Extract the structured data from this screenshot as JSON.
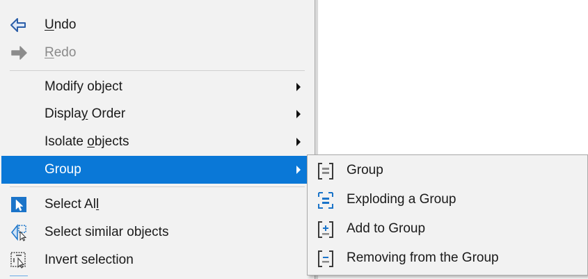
{
  "context_menu": {
    "items": [
      {
        "label_pre": "",
        "label_ul": "U",
        "label_post": "ndo",
        "icon": "undo-arrow-icon"
      },
      {
        "label_pre": "",
        "label_ul": "R",
        "label_post": "edo",
        "icon": "redo-arrow-icon"
      },
      {
        "label_pre": "Modify object",
        "label_ul": "",
        "label_post": ""
      },
      {
        "label_pre": "Displa",
        "label_ul": "y",
        "label_post": " Order"
      },
      {
        "label_pre": "Isolate ",
        "label_ul": "o",
        "label_post": "bjects"
      },
      {
        "label_pre": "Group",
        "label_ul": "",
        "label_post": ""
      },
      {
        "label_pre": "Select Al",
        "label_ul": "l",
        "label_post": "",
        "icon": "select-all-icon"
      },
      {
        "label_pre": "Select similar objects",
        "label_ul": "",
        "label_post": "",
        "icon": "select-similar-icon"
      },
      {
        "label_pre": "Invert selection",
        "label_ul": "",
        "label_post": "",
        "icon": "invert-selection-icon"
      }
    ]
  },
  "group_submenu": {
    "items": [
      {
        "label": "Group",
        "icon": "group-icon"
      },
      {
        "label": "Exploding a Group",
        "icon": "explode-group-icon"
      },
      {
        "label": "Add to Group",
        "icon": "add-to-group-icon"
      },
      {
        "label": "Removing from the Group",
        "icon": "remove-from-group-icon"
      }
    ]
  },
  "colors": {
    "highlight": "#0a78d7",
    "menu_bg": "#f2f2f2"
  }
}
